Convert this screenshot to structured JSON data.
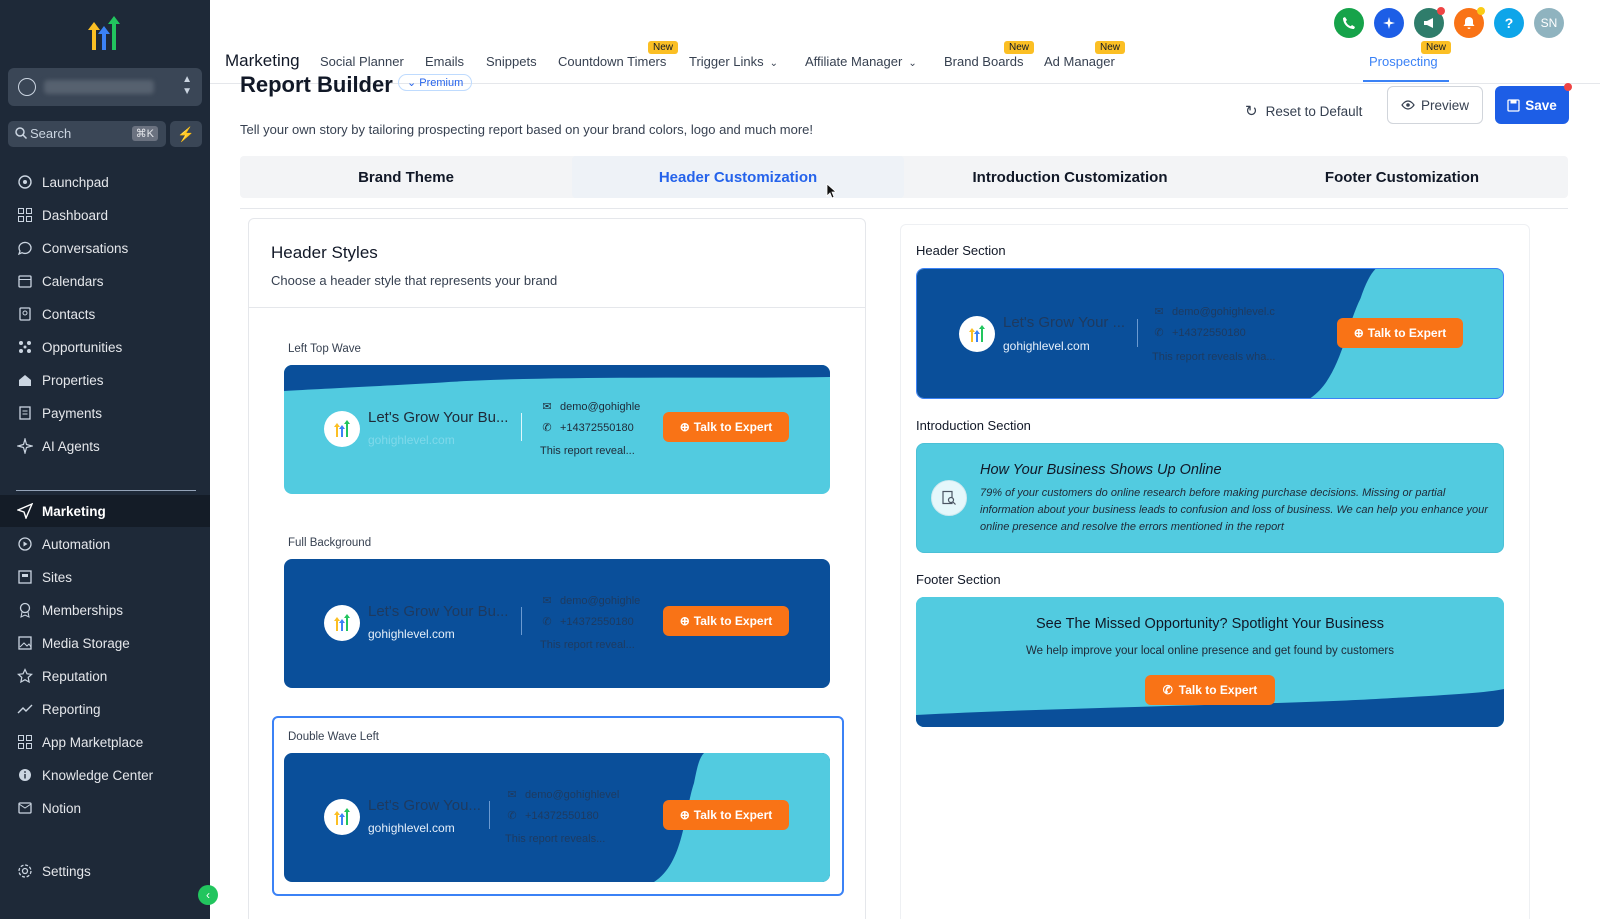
{
  "sidebar": {
    "search": {
      "placeholder": "Search",
      "shortcut": "⌘K"
    },
    "items": [
      {
        "label": "Launchpad",
        "icon": "rocket-icon"
      },
      {
        "label": "Dashboard",
        "icon": "grid-icon"
      },
      {
        "label": "Conversations",
        "icon": "chat-icon"
      },
      {
        "label": "Calendars",
        "icon": "calendar-icon"
      },
      {
        "label": "Contacts",
        "icon": "contacts-icon"
      },
      {
        "label": "Opportunities",
        "icon": "opportunities-icon"
      },
      {
        "label": "Properties",
        "icon": "home-icon"
      },
      {
        "label": "Payments",
        "icon": "receipt-icon"
      },
      {
        "label": "AI Agents",
        "icon": "sparkle-icon"
      },
      {
        "label": "Marketing",
        "icon": "send-icon",
        "active": true
      },
      {
        "label": "Automation",
        "icon": "automation-icon"
      },
      {
        "label": "Sites",
        "icon": "sites-icon"
      },
      {
        "label": "Memberships",
        "icon": "membership-icon"
      },
      {
        "label": "Media Storage",
        "icon": "image-icon"
      },
      {
        "label": "Reputation",
        "icon": "star-icon"
      },
      {
        "label": "Reporting",
        "icon": "trend-icon"
      },
      {
        "label": "App Marketplace",
        "icon": "apps-icon"
      },
      {
        "label": "Knowledge Center",
        "icon": "info-icon"
      },
      {
        "label": "Notion",
        "icon": "notion-icon"
      }
    ],
    "settings": "Settings"
  },
  "topbar": {
    "section": "Marketing",
    "tabs": [
      {
        "label": "Social Planner"
      },
      {
        "label": "Emails"
      },
      {
        "label": "Snippets"
      },
      {
        "label": "Countdown Timers",
        "badge": "New"
      },
      {
        "label": "Trigger Links"
      },
      {
        "label": "Affiliate Manager"
      },
      {
        "label": "Brand Boards",
        "badge": "New"
      },
      {
        "label": "Ad Manager",
        "badge": "New"
      },
      {
        "label": "Prospecting",
        "badge": "New",
        "active": true
      }
    ],
    "avatar_initials": "SN",
    "help_label": "?"
  },
  "page": {
    "title": "Report Builder",
    "premium": "Premium",
    "subtitle": "Tell your own story by tailoring prospecting report based on your brand colors, logo and much more!",
    "reset": "Reset to Default",
    "preview": "Preview",
    "save": "Save",
    "segments": [
      "Brand Theme",
      "Header Customization",
      "Introduction Customization",
      "Footer Customization"
    ]
  },
  "header_styles": {
    "title": "Header Styles",
    "subtitle": "Choose a header style that represents your brand",
    "options": [
      {
        "label": "Left Top Wave",
        "title": "Let's Grow Your Bu...",
        "site": "gohighlevel.com",
        "email": "demo@gohighle",
        "phone": "+14372550180",
        "desc": "This report reveal...",
        "cta": "Talk to Expert"
      },
      {
        "label": "Full Background",
        "title": "Let's Grow Your Bu...",
        "site": "gohighlevel.com",
        "email": "demo@gohighle",
        "phone": "+14372550180",
        "desc": "This report reveal...",
        "cta": "Talk to Expert"
      },
      {
        "label": "Double Wave Left",
        "title": "Let's Grow You...",
        "site": "gohighlevel.com",
        "email": "demo@gohighlevel",
        "phone": "+14372550180",
        "desc": "This report reveals...",
        "cta": "Talk to Expert",
        "selected": true
      }
    ]
  },
  "preview_panel": {
    "header_section_label": "Header Section",
    "header": {
      "title": "Let's Grow Your ...",
      "site": "gohighlevel.com",
      "email": "demo@gohighlevel.c",
      "phone": "+14372550180",
      "desc": "This report reveals wha...",
      "cta": "Talk to Expert"
    },
    "intro_section_label": "Introduction Section",
    "intro": {
      "title": "How Your Business Shows Up Online",
      "body": "79% of your customers do online research before making purchase decisions. Missing or partial information about your business leads to confusion and loss of business. We can help you enhance your online presence and resolve the errors mentioned in the report"
    },
    "footer_section_label": "Footer Section",
    "footer": {
      "title": "See The Missed Opportunity? Spotlight Your Business",
      "subtitle": "We help improve your local online presence and get found by customers",
      "cta": "Talk to Expert"
    }
  },
  "colors": {
    "dark_blue": "#0a4f9a",
    "light_teal": "#52cbe0",
    "orange": "#f97316",
    "accent": "#1d5ee6",
    "sidebar_bg": "#1e2938"
  }
}
